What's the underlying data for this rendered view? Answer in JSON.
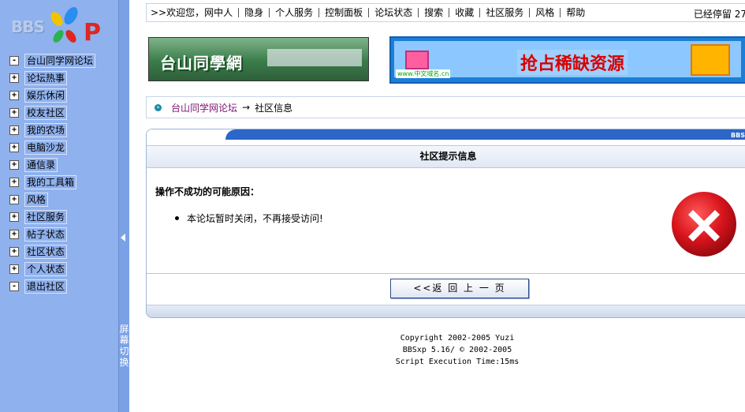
{
  "sidebar": {
    "logo": {
      "text": "BBS",
      "letter": "P"
    },
    "items": [
      {
        "toggle": "-",
        "label": "台山同学网论坛"
      },
      {
        "toggle": "+",
        "label": "论坛热事"
      },
      {
        "toggle": "+",
        "label": "娱乐休闲"
      },
      {
        "toggle": "+",
        "label": "校友社区"
      },
      {
        "toggle": "+",
        "label": "我的农场"
      },
      {
        "toggle": "+",
        "label": "电脑沙龙"
      },
      {
        "toggle": "+",
        "label": "通信录"
      },
      {
        "toggle": "+",
        "label": "我的工具箱"
      },
      {
        "toggle": "+",
        "label": "风格"
      },
      {
        "toggle": "+",
        "label": "社区服务"
      },
      {
        "toggle": "+",
        "label": "帖子状态"
      },
      {
        "toggle": "+",
        "label": "社区状态"
      },
      {
        "toggle": "+",
        "label": "个人状态"
      },
      {
        "toggle": "-",
        "label": "退出社区"
      }
    ],
    "splitter_label": "屏幕切换"
  },
  "topbar": {
    "welcome": ">>欢迎您，",
    "items": [
      "网中人",
      "隐身",
      "个人服务",
      "控制面板",
      "论坛状态",
      "搜索",
      "收藏",
      "社区服务",
      "风格",
      "帮助"
    ],
    "stay": "已经停留 27"
  },
  "banners": {
    "left_text": "台山同學網",
    "right_text": "抢占稀缺资源",
    "right_small": "www.中文域名.cn"
  },
  "breadcrumb": {
    "link": "台山同学网论坛",
    "separator": "→",
    "current": "社区信息"
  },
  "panel": {
    "tag": "BBS",
    "title": "社区提示信息",
    "heading": "操作不成功的可能原因：",
    "reason": "本论坛暂时关闭，不再接受访问!",
    "back_button": "<<返 回 上 一 页"
  },
  "footer": {
    "line1": "Copyright 2002-2005 Yuzi",
    "line2": "BBSxp 5.16/ © 2002-2005",
    "line3": "Script Execution Time:15ms"
  },
  "colors": {
    "sidebar_bg": "#8fb1ed",
    "splitter_bg": "#7aa1e6",
    "panel_header": "#2b66c8",
    "error_red": "#d8141c",
    "link": "#7a1470"
  }
}
